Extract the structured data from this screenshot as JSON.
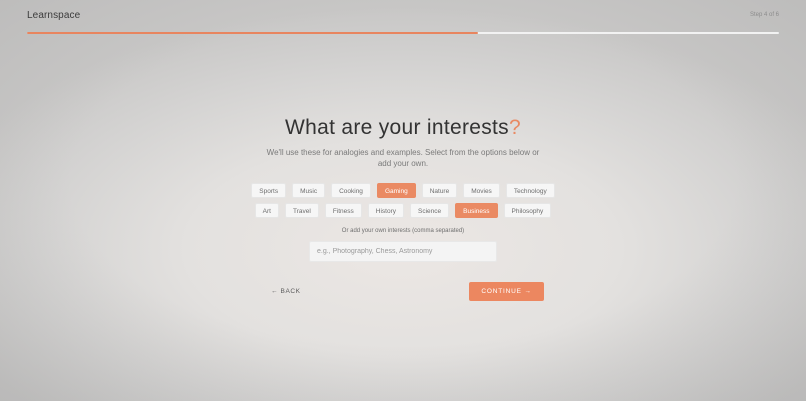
{
  "app": {
    "logo": "Learnspace",
    "step": "Step 4 of 6"
  },
  "progress": {
    "fraction": 0.6,
    "fill_color": "#e8855f",
    "track_color": "#f2f2f2"
  },
  "page": {
    "title": "What are your interests",
    "title_mark": "?",
    "subtitle_line1": "We'll use these for analogies and examples. Select from the options below or",
    "subtitle_line2": "add your own."
  },
  "interests": {
    "row1": [
      {
        "label": "Sports",
        "selected": false
      },
      {
        "label": "Music",
        "selected": false
      },
      {
        "label": "Cooking",
        "selected": false
      },
      {
        "label": "Gaming",
        "selected": true
      },
      {
        "label": "Nature",
        "selected": false
      },
      {
        "label": "Movies",
        "selected": false
      },
      {
        "label": "Technology",
        "selected": false
      }
    ],
    "row2": [
      {
        "label": "Art",
        "selected": false
      },
      {
        "label": "Travel",
        "selected": false
      },
      {
        "label": "Fitness",
        "selected": false
      },
      {
        "label": "History",
        "selected": false
      },
      {
        "label": "Science",
        "selected": false
      },
      {
        "label": "Business",
        "selected": true
      },
      {
        "label": "Philosophy",
        "selected": false
      }
    ]
  },
  "custom": {
    "label": "Or add your own interests (comma separated)",
    "placeholder": "e.g., Photography, Chess, Astronomy",
    "value": ""
  },
  "nav": {
    "back_label": "← BACK",
    "continue_label": "CONTINUE →"
  },
  "colors": {
    "accent": "#ea8a63",
    "text": "#333333"
  }
}
